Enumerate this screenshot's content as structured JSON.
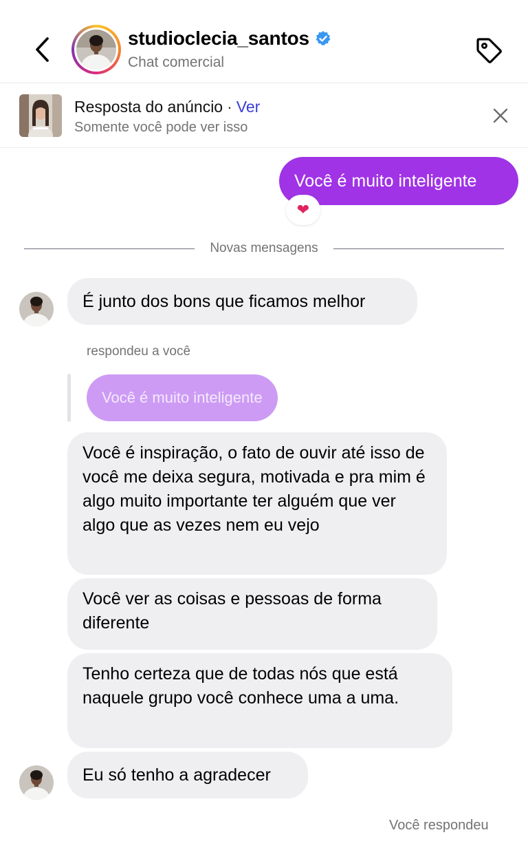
{
  "header": {
    "username": "studioclecia_santos",
    "subtitle": "Chat comercial",
    "verified": true,
    "back_icon": "chevron-left-icon",
    "tag_icon": "tag-icon",
    "ring_colors": [
      "#f9c52b",
      "#f58529",
      "#dd2a7b",
      "#8134af"
    ]
  },
  "ad_banner": {
    "title": "Resposta do anúncio",
    "separator": "·",
    "link_label": "Ver",
    "subtitle": "Somente você pode ver isso",
    "close_icon": "close-icon"
  },
  "messages": {
    "sent_1": "Você é muito inteligente",
    "sent_1_reaction": "❤️",
    "divider_label": "Novas mensagens",
    "received_1": "É junto dos bons que ficamos melhor",
    "replied_label": "respondeu a você",
    "quoted_text": "Você é muito inteligente",
    "received_2": "Você é inspiração, o fato de ouvir até isso de você me deixa segura, motivada e pra mim é algo muito importante ter alguém que ver algo que as vezes nem eu vejo",
    "received_3": "Você ver as coisas e pessoas de forma diferente",
    "received_4": "Tenho certeza que de todas nós que está naquele grupo você conhece uma a uma.",
    "received_5": "Eu só tenho a agradecer",
    "status": "Você respondeu"
  },
  "colors": {
    "sent_bubble": "#a033e6",
    "received_bubble": "#efeff1",
    "quoted_bubble": "#cd9bf4",
    "link": "#3a3fd8",
    "verified_badge": "#3897f0",
    "secondary_text": "#737373"
  }
}
